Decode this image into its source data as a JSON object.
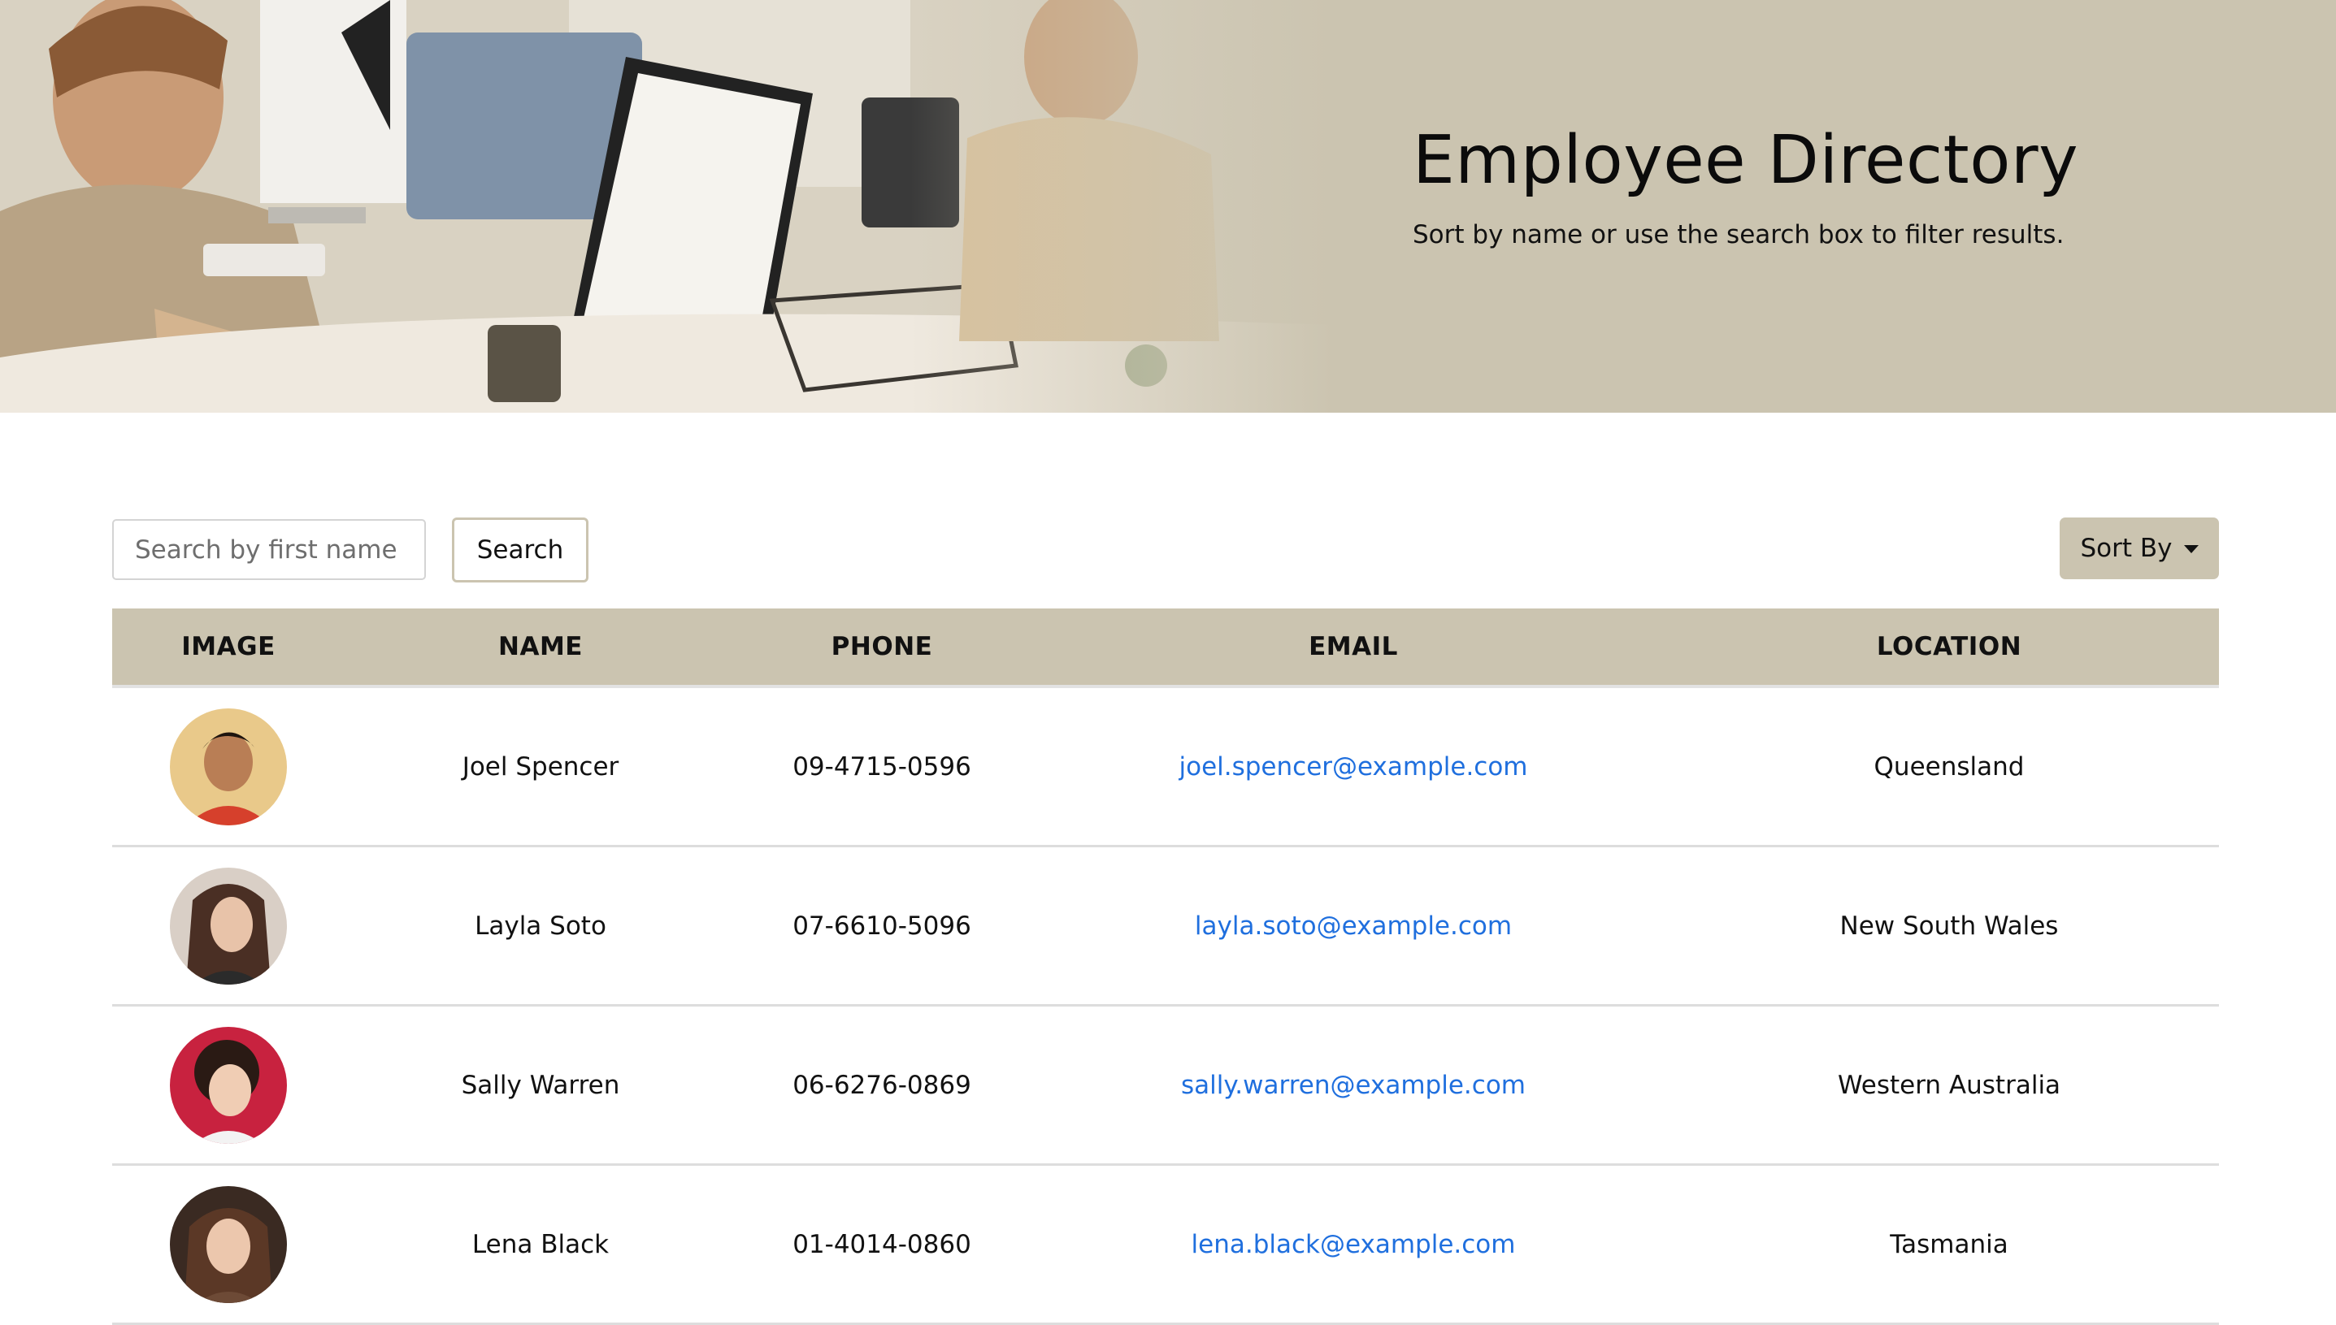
{
  "hero": {
    "title": "Employee Directory",
    "subtitle": "Sort by name or use the search box to filter results."
  },
  "controls": {
    "search_placeholder": "Search by first name",
    "search_value": "",
    "search_label": "Search",
    "sort_label": "Sort By"
  },
  "table": {
    "headers": [
      "IMAGE",
      "NAME",
      "PHONE",
      "EMAIL",
      "LOCATION"
    ],
    "rows": [
      {
        "name": "Joel Spencer",
        "phone": "09-4715-0596",
        "email": "joel.spencer@example.com",
        "location": "Queensland"
      },
      {
        "name": "Layla Soto",
        "phone": "07-6610-5096",
        "email": "layla.soto@example.com",
        "location": "New South Wales"
      },
      {
        "name": "Sally Warren",
        "phone": "06-6276-0869",
        "email": "sally.warren@example.com",
        "location": "Western Australia"
      },
      {
        "name": "Lena Black",
        "phone": "01-4014-0860",
        "email": "lena.black@example.com",
        "location": "Tasmania"
      }
    ]
  },
  "colors": {
    "accent": "#cbc4b0",
    "link": "#1f6fde",
    "border": "#dddddd"
  }
}
